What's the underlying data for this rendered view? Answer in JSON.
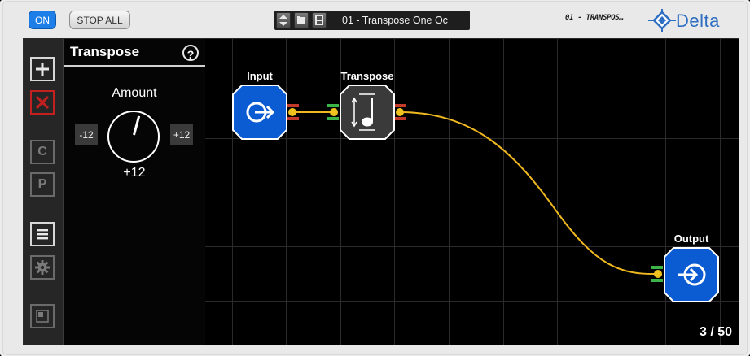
{
  "toolbar": {
    "on_label": "ON",
    "stop_all_label": "STOP ALL",
    "preset_name": "01 - Transpose One Oc",
    "handwritten_note": "01 - TRANSPOS…",
    "brand_name": "Delta",
    "accent_color": "#1d7ee8"
  },
  "tools": [
    {
      "name": "add-module-icon"
    },
    {
      "name": "delete-module-icon"
    },
    {
      "name": "copy-button",
      "label": "C"
    },
    {
      "name": "paste-button",
      "label": "P"
    },
    {
      "name": "list-icon"
    },
    {
      "name": "settings-gear-icon"
    },
    {
      "name": "panel-toggle-icon"
    }
  ],
  "param_panel": {
    "title": "Transpose",
    "help": "?",
    "amount_label": "Amount",
    "min_label": "-12",
    "max_label": "+12",
    "value_label": "+12"
  },
  "canvas": {
    "modules": [
      {
        "name": "Input",
        "type": "input",
        "color": "#0b5bd3"
      },
      {
        "name": "Transpose",
        "type": "transpose",
        "color": "#3a3a3a"
      },
      {
        "name": "Output",
        "type": "output",
        "color": "#0b5bd3"
      }
    ],
    "wire_color": "#f0b81f",
    "counter": "3 / 50"
  }
}
